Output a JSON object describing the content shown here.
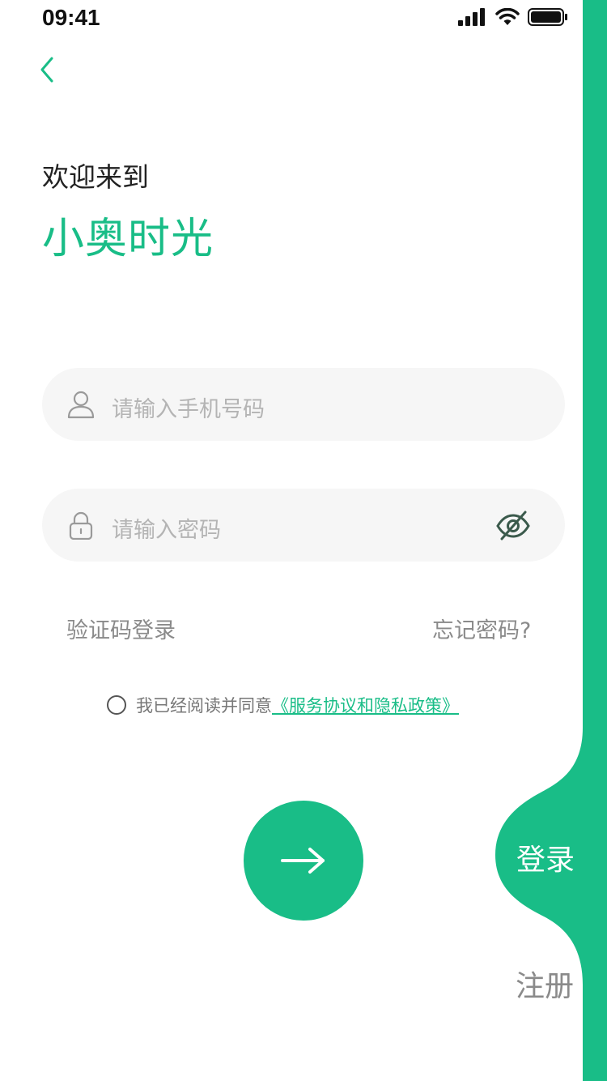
{
  "status_bar": {
    "time": "09:41",
    "icons": [
      "signal-icon",
      "wifi-icon",
      "battery-icon"
    ]
  },
  "nav": {
    "back_icon": "chevron-left-icon"
  },
  "header": {
    "welcome": "欢迎来到",
    "brand": "小奥时光"
  },
  "form": {
    "phone": {
      "placeholder": "请输入手机号码",
      "icon": "user-icon"
    },
    "password": {
      "placeholder": "请输入密码",
      "icon": "lock-icon",
      "toggle_icon": "eye-off-icon"
    }
  },
  "links": {
    "sms_login": "验证码登录",
    "forgot_password": "忘记密码?"
  },
  "agreement": {
    "text": "我已经阅读并同意",
    "link": "《服务协议和隐私政策》",
    "checked": false
  },
  "submit": {
    "icon": "arrow-right-icon"
  },
  "side_tabs": {
    "login": "登录",
    "register": "注册",
    "active": "login"
  },
  "colors": {
    "accent": "#19bd87",
    "field_bg": "#f6f6f6",
    "placeholder": "#b4b4b4",
    "muted_text": "#8a8a8a"
  }
}
